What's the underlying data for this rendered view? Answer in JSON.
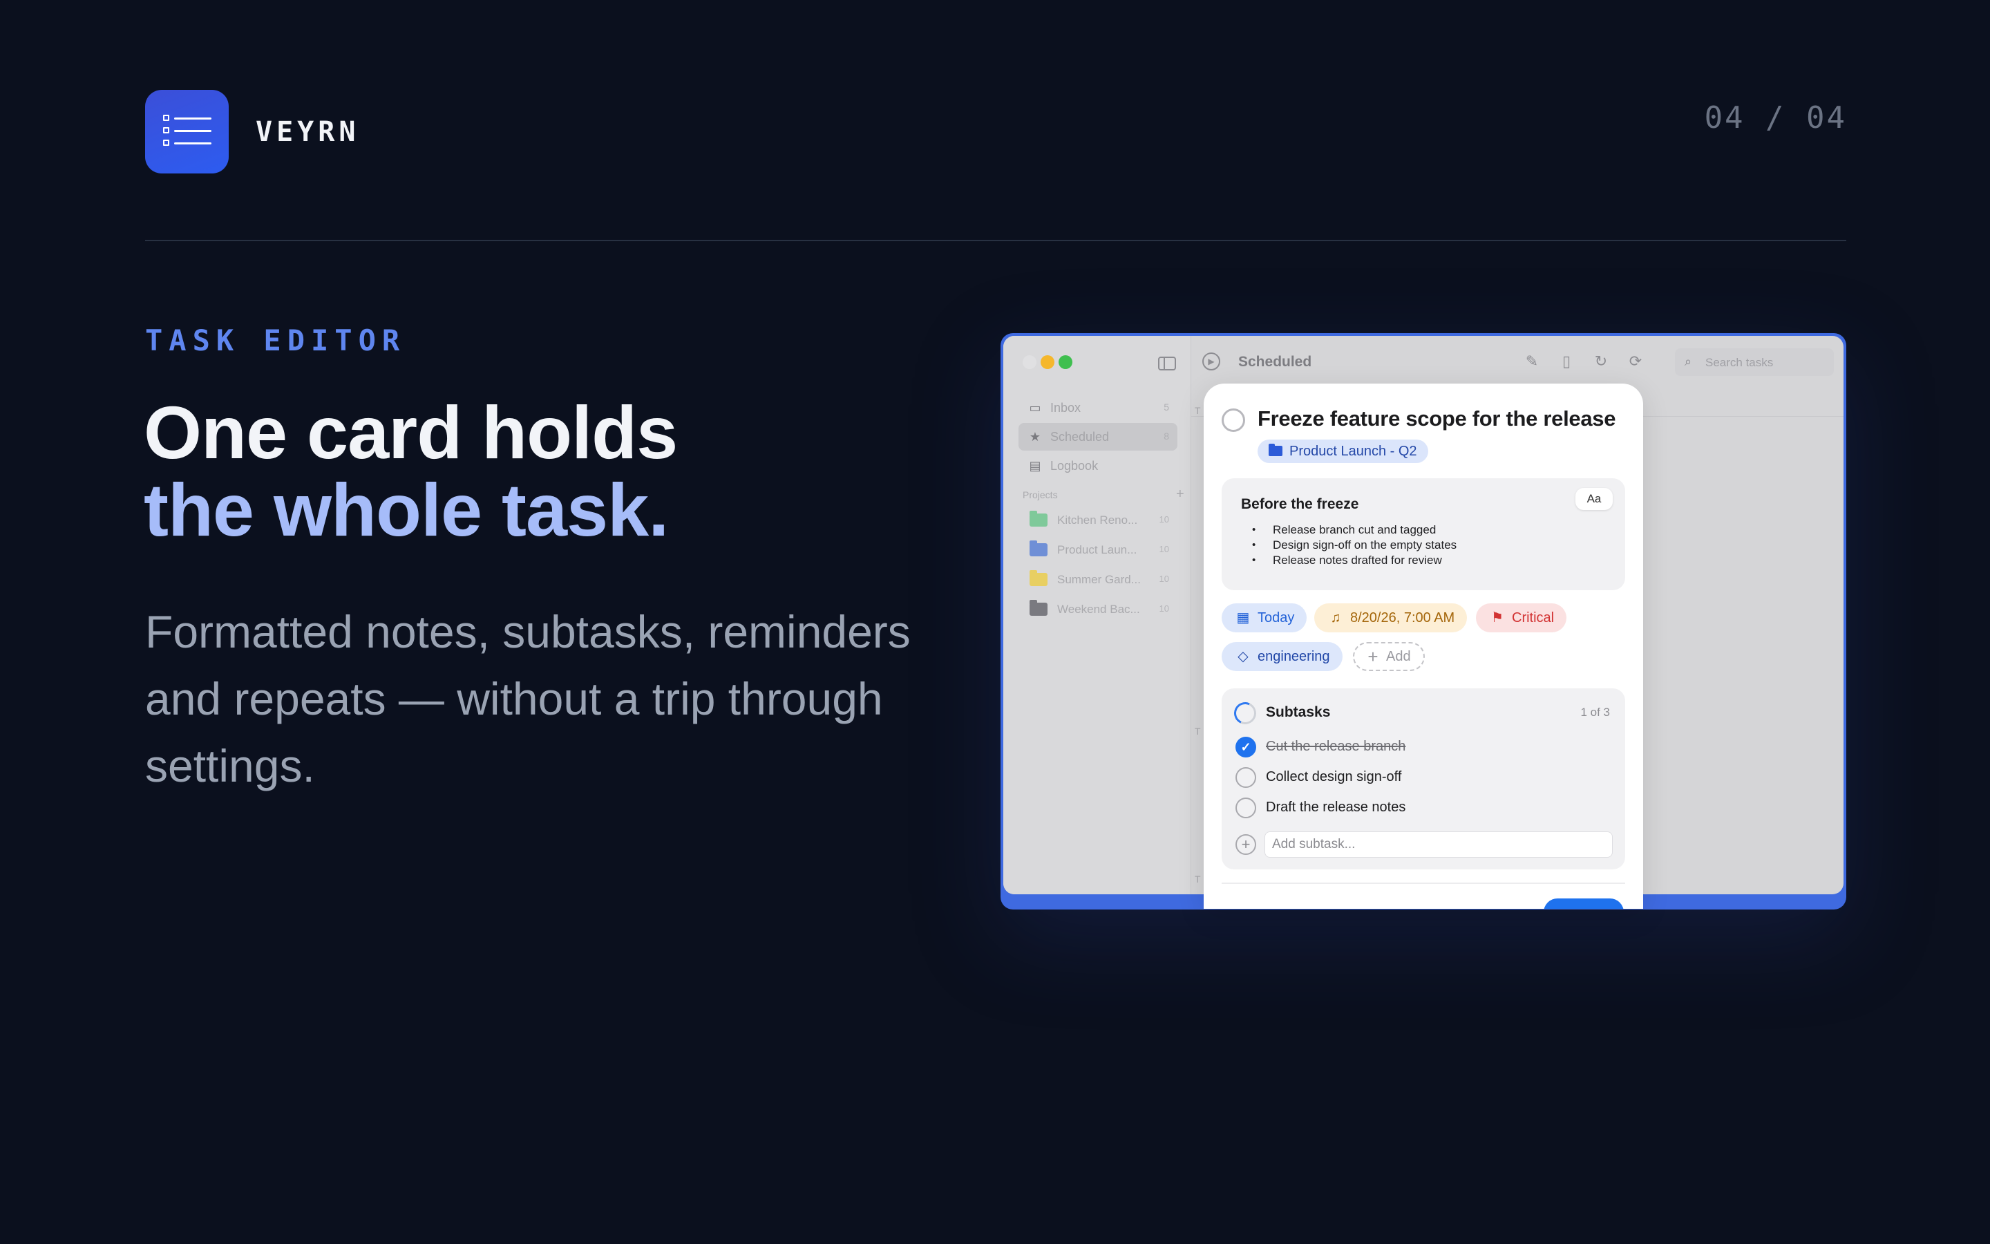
{
  "brand": {
    "name": "VEYRN",
    "logo_icon": "checklist-icon",
    "accent": "#2d5cf0"
  },
  "pager": "04 / 04",
  "eyebrow": "TASK EDITOR",
  "headline": {
    "line1": "One card holds",
    "line2": "the whole task."
  },
  "subcopy": "Formatted notes, subtasks, reminders and repeats — without a trip through settings.",
  "window": {
    "toolbar": {
      "title": "Scheduled",
      "search_placeholder": "Search tasks",
      "icons": [
        "compose-icon",
        "document-icon",
        "refresh-icon",
        "sync-icon"
      ]
    },
    "sidebar": {
      "nav": [
        {
          "label": "Inbox",
          "count": "5",
          "icon": "inbox-icon"
        },
        {
          "label": "Scheduled",
          "count": "8",
          "icon": "star-icon"
        },
        {
          "label": "Logbook",
          "count": "",
          "icon": "archive-icon"
        }
      ],
      "projects_header": "Projects",
      "projects": [
        {
          "label": "Kitchen Reno...",
          "count": "10",
          "color": "#7fc99a"
        },
        {
          "label": "Product Laun...",
          "count": "10",
          "color": "#6f8fd6"
        },
        {
          "label": "Summer Gard...",
          "count": "10",
          "color": "#e8cf62"
        },
        {
          "label": "Weekend Bac...",
          "count": "10",
          "color": "#7a7a80"
        }
      ]
    },
    "list_peek": [
      "T",
      "T",
      "T"
    ]
  },
  "task": {
    "title": "Freeze feature scope for the release",
    "project": "Product Launch - Q2",
    "notes": {
      "title": "Before the freeze",
      "format_button": "Aa",
      "items": [
        "Release branch cut and tagged",
        "Design sign-off on the empty states",
        "Release notes drafted for review"
      ]
    },
    "chips": {
      "due": "Today",
      "reminder": "8/20/26, 7:00 AM",
      "priority": "Critical",
      "tag": "engineering",
      "add": "Add"
    },
    "subtasks": {
      "title": "Subtasks",
      "count": "1 of 3",
      "progress": 0.33,
      "items": [
        {
          "label": "Cut the release branch",
          "done": true
        },
        {
          "label": "Collect design sign-off",
          "done": false
        },
        {
          "label": "Draft the release notes",
          "done": false
        }
      ],
      "add_placeholder": "Add subtask..."
    }
  }
}
